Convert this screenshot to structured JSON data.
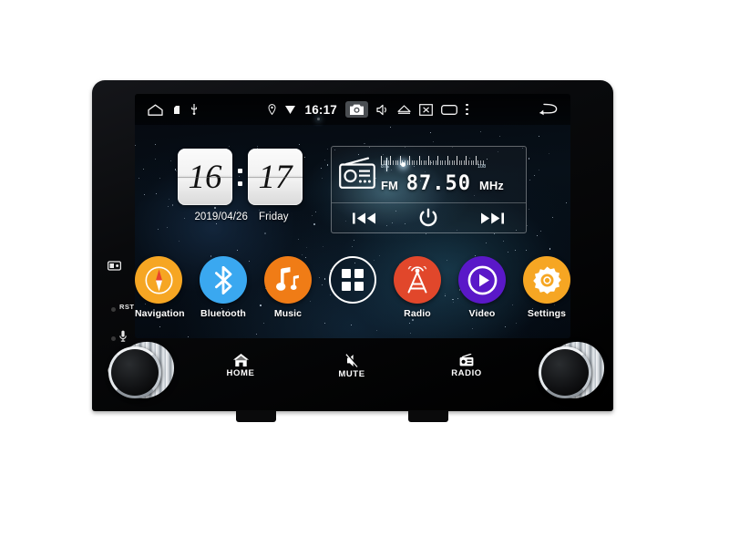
{
  "device": {
    "type": "car-head-unit",
    "os": "android-auto-radio"
  },
  "statusbar": {
    "left_icons": [
      {
        "name": "home-outline-icon",
        "glyph": "home-outline"
      },
      {
        "name": "sd-card-icon",
        "glyph": "sd-card"
      },
      {
        "name": "usb-icon",
        "glyph": "usb"
      }
    ],
    "location_icon": "location-pin-icon",
    "signal_icon": "signal-triangle-icon",
    "clock": "16:17",
    "camera_icon": "camera-icon",
    "volume_icon": "volume-icon",
    "eject_icon": "eject-icon",
    "screen_off_icon": "screen-off-icon",
    "recents_icon": "recents-icon",
    "overflow_icon": "overflow-menu-icon",
    "back_icon": "back-arrow-icon"
  },
  "clock_widget": {
    "hours": "16",
    "minutes": "17",
    "date": "2019/04/26",
    "weekday": "Friday"
  },
  "radio_widget": {
    "icon": "radio-icon",
    "band": "FM",
    "frequency": "87.50",
    "unit": "MHz",
    "scale_min": "87",
    "scale_max": "108",
    "controls": {
      "prev": "previous-track-button",
      "power": "power-button",
      "next": "next-track-button"
    }
  },
  "dock": {
    "apps": [
      {
        "label": "Navigation",
        "icon": "compass-icon",
        "color": "#f6a623"
      },
      {
        "label": "Bluetooth",
        "icon": "bluetooth-icon",
        "color": "#3aa8f0"
      },
      {
        "label": "Music",
        "icon": "music-note-icon",
        "color": "#f07c16"
      },
      {
        "label": "",
        "icon": "apps-grid-icon",
        "color": "transparent"
      },
      {
        "label": "Radio",
        "icon": "radio-tower-icon",
        "color": "#e1472b"
      },
      {
        "label": "Video",
        "icon": "play-circle-icon",
        "color": "#5a18c8"
      },
      {
        "label": "Settings",
        "icon": "gear-icon",
        "color": "#f6a623"
      }
    ]
  },
  "bezel": {
    "left": {
      "sd_icon": "sd-card-slot-icon",
      "reset_label": "RST",
      "mic_icon": "microphone-icon",
      "power_icon": "power-icon"
    },
    "buttons": [
      {
        "label": "HOME",
        "icon": "home-icon"
      },
      {
        "label": "MUTE",
        "icon": "mute-icon"
      },
      {
        "label": "RADIO",
        "icon": "radio-device-icon"
      }
    ],
    "knobs": [
      {
        "name": "volume-knob-left"
      },
      {
        "name": "tune-knob-right"
      }
    ]
  }
}
